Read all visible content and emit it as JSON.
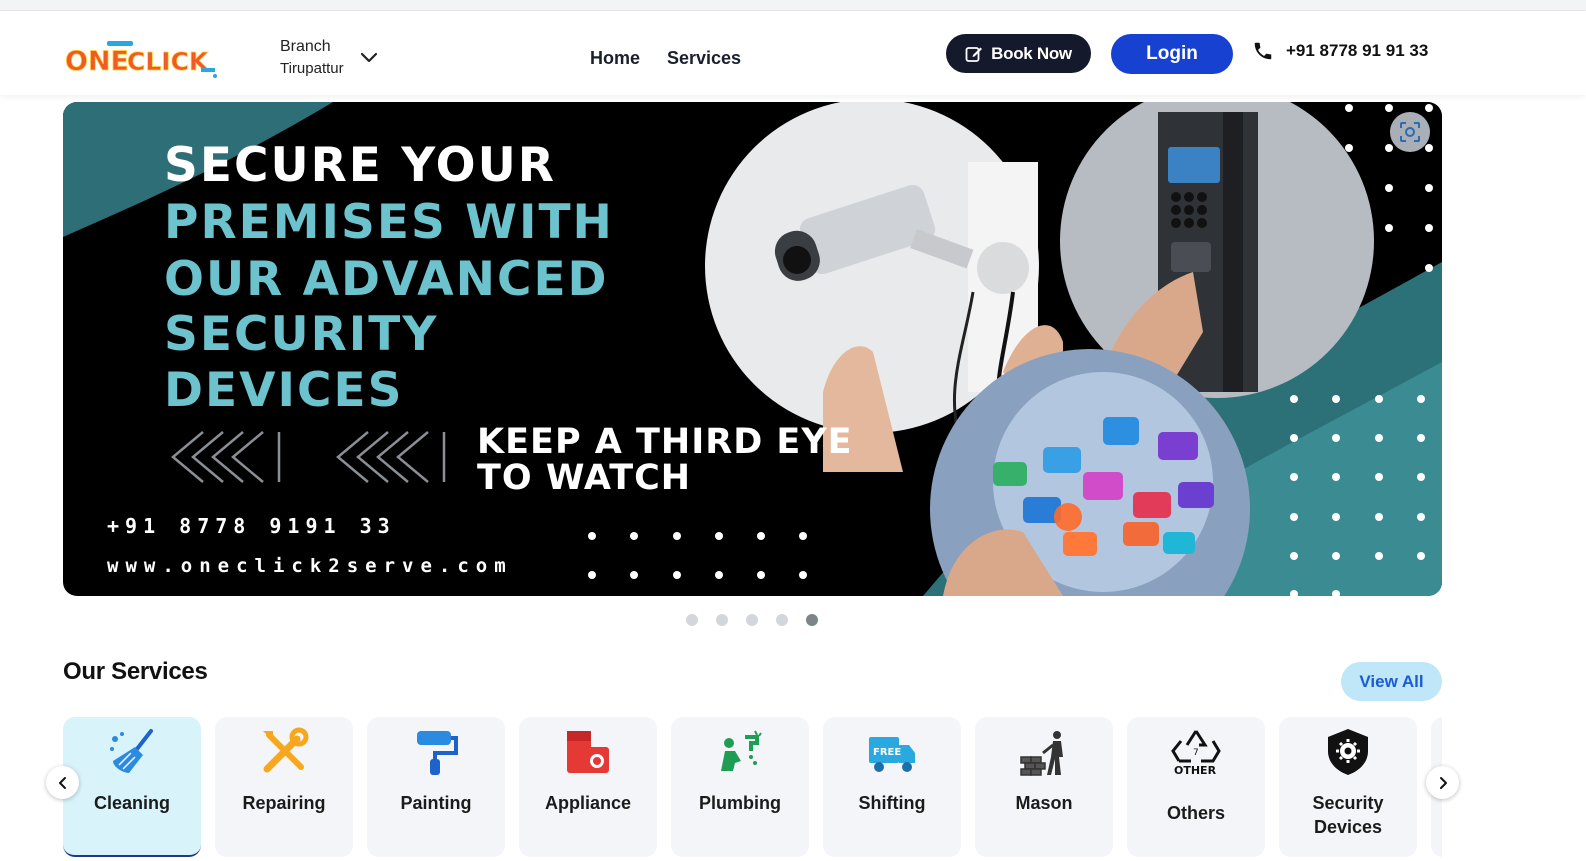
{
  "header": {
    "logo_text": "ONE CLICK",
    "branch_label": "Branch",
    "branch_value": "Tirupattur",
    "nav": [
      "Home",
      "Services"
    ],
    "book_label": "Book Now",
    "login_label": "Login",
    "phone": "+91 8778 91 91 33"
  },
  "banner": {
    "line1": "SECURE YOUR",
    "line2": "PREMISES WITH",
    "line3": "OUR ADVANCED",
    "line4": "SECURITY",
    "line5": "DEVICES",
    "tag1": "KEEP A THIRD EYE",
    "tag2": "TO WATCH",
    "phone": "+91 8778 9191 33",
    "website": "www.oneclick2serve.com",
    "slide_count": 5,
    "active_slide": 5
  },
  "services": {
    "title": "Our Services",
    "view_all": "View All",
    "items": [
      {
        "label": "Cleaning",
        "icon": "broom-icon"
      },
      {
        "label": "Repairing",
        "icon": "tools-icon"
      },
      {
        "label": "Painting",
        "icon": "paint-roller-icon"
      },
      {
        "label": "Appliance",
        "icon": "appliance-icon"
      },
      {
        "label": "Plumbing",
        "icon": "plumber-icon"
      },
      {
        "label": "Shifting",
        "icon": "truck-icon"
      },
      {
        "label": "Mason",
        "icon": "mason-icon"
      },
      {
        "label": "Others",
        "icon": "recycle-icon",
        "icon_text": "OTHER"
      },
      {
        "label": "Security Devices",
        "icon": "shield-gear-icon"
      }
    ]
  },
  "colors": {
    "primary_dark": "#141a2b",
    "login_blue": "#1641d1",
    "banner_teal": "#6cc3ce",
    "active_card": "#d9f3fb",
    "view_all_bg": "#bfe7f7"
  }
}
